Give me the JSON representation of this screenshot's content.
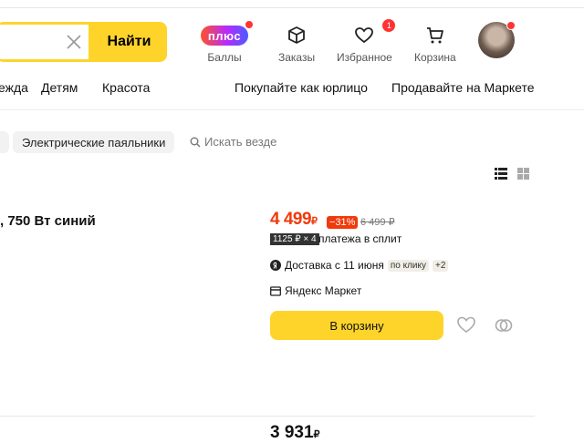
{
  "search": {
    "value": "",
    "button_label": "Найти"
  },
  "header": {
    "nav": [
      {
        "label": "Баллы",
        "badge": "плюс"
      },
      {
        "label": "Заказы"
      },
      {
        "label": "Избранное",
        "count": "1"
      },
      {
        "label": "Корзина"
      }
    ]
  },
  "categories": {
    "left": [
      "ежда",
      "Детям",
      "Красота"
    ],
    "right": [
      "Покупайте как юрлицо",
      "Продавайте на Маркете"
    ]
  },
  "filters": {
    "chip": "Электрические паяльники",
    "search_all": "Искать везде"
  },
  "product": {
    "title_fragment": ", 750 Вт синий",
    "price": "4 499",
    "currency": "₽",
    "discount": "−31%",
    "old_price": "6 499 ₽",
    "split_badge": "1125 ₽ × 4",
    "split_text": "платежа в сплит",
    "delivery_text": "Доставка с 11 июня",
    "delivery_tag": "по клику",
    "delivery_more": "+2",
    "seller": "Яндекс Маркет",
    "cart_button": "В корзину"
  },
  "next_product": {
    "price": "3 931",
    "currency": "₽"
  },
  "colors": {
    "accent": "#fed42b",
    "price_red": "#f13a0c"
  }
}
